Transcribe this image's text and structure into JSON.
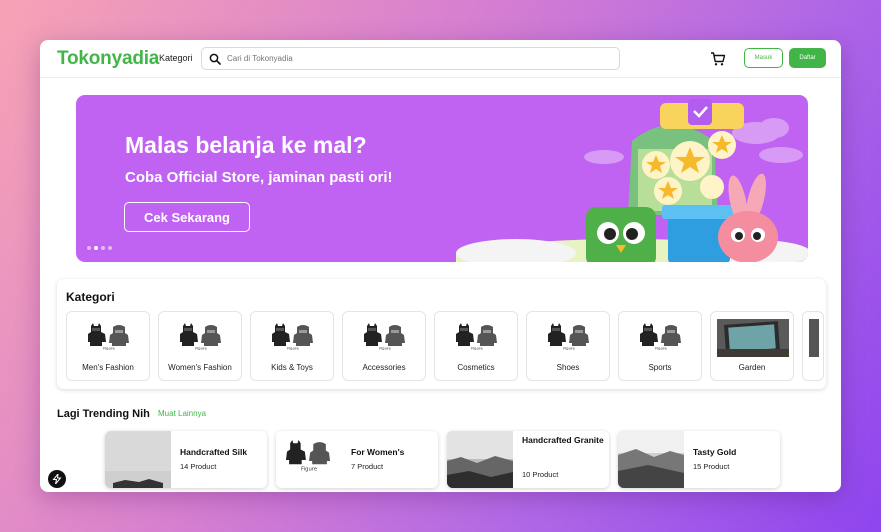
{
  "header": {
    "logo": "Tokonyadia",
    "kategori_label": "Kategori",
    "search_placeholder": "Cari di Tokonyadia",
    "masuk_label": "Masuk",
    "daftar_label": "Daftar"
  },
  "banner": {
    "title": "Malas belanja ke mal?",
    "subtitle": "Coba Official Store, jaminan pasti ori!",
    "button_label": "Cek Sekarang",
    "slide_count": 3,
    "active_slide": 2
  },
  "categories": {
    "title": "Kategori",
    "figure_caption": "Figure",
    "items": [
      {
        "label": "Men's Fashion"
      },
      {
        "label": "Women's Fashion"
      },
      {
        "label": "Kids & Toys"
      },
      {
        "label": "Accessories"
      },
      {
        "label": "Cosmetics"
      },
      {
        "label": "Shoes"
      },
      {
        "label": "Sports"
      },
      {
        "label": "Garden"
      }
    ]
  },
  "trending": {
    "title": "Lagi Trending Nih",
    "more_label": "Muat Lainnya",
    "items": [
      {
        "name": "Handcrafted Silk",
        "count": "14 Product"
      },
      {
        "name": "For Women's",
        "count": "7 Product"
      },
      {
        "name": "Handcrafted Granite",
        "count": "10 Product"
      },
      {
        "name": "Tasty Gold",
        "count": "15 Product"
      }
    ]
  },
  "colors": {
    "brand_green": "#42b549",
    "banner_purple": "#c163f2"
  },
  "icons": [
    "search-icon",
    "cart-icon",
    "bolt-icon"
  ]
}
